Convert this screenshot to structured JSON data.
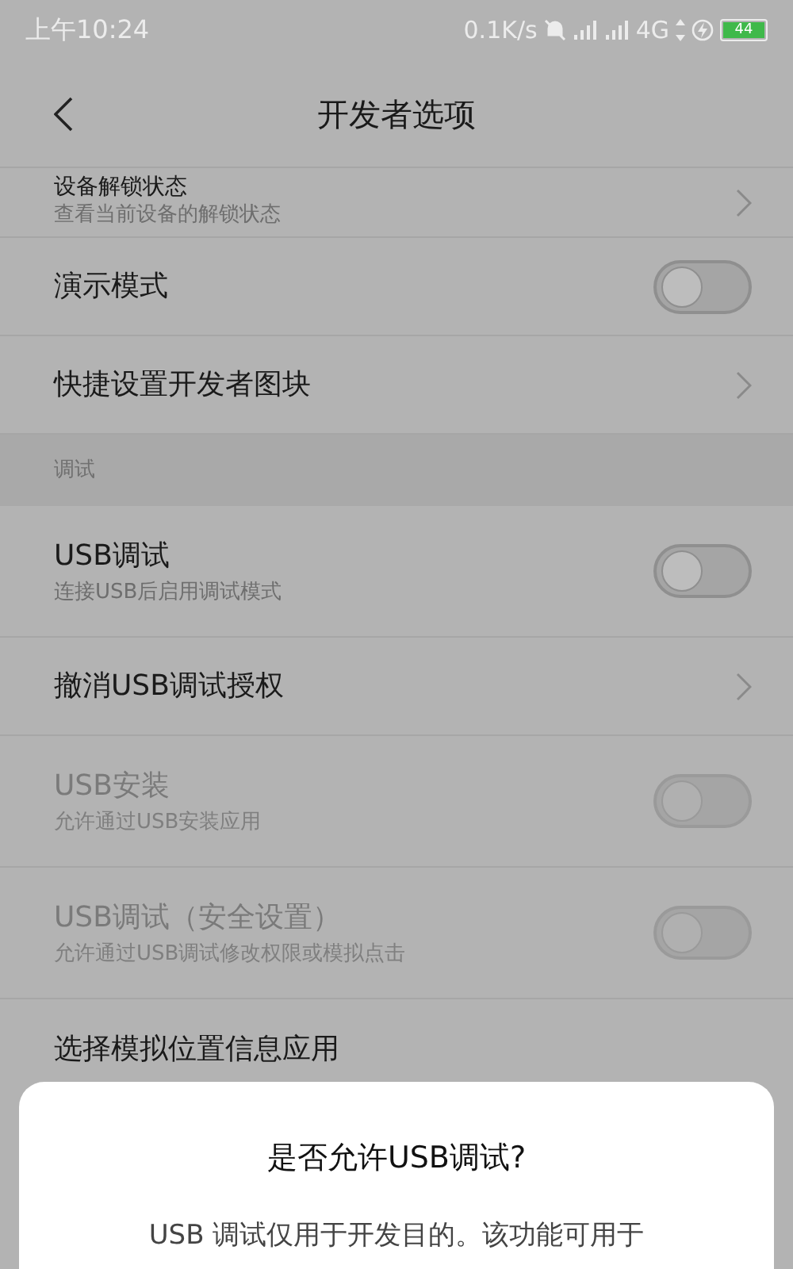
{
  "status_bar": {
    "time": "上午10:24",
    "speed": "0.1K/s",
    "network": "4G",
    "battery": "44"
  },
  "header": {
    "title": "开发者选项"
  },
  "rows": [
    {
      "kind": "link",
      "title": "设备解锁状态",
      "subtitle": "查看当前设备的解锁状态",
      "disabled": false
    },
    {
      "kind": "toggle",
      "title": "演示模式",
      "on": false,
      "disabled": false
    },
    {
      "kind": "link",
      "title": "快捷设置开发者图块",
      "disabled": false
    },
    {
      "kind": "section",
      "title": "调试"
    },
    {
      "kind": "toggle",
      "title": "USB调试",
      "subtitle": "连接USB后启用调试模式",
      "on": false,
      "disabled": false
    },
    {
      "kind": "link",
      "title": "撤消USB调试授权",
      "disabled": false
    },
    {
      "kind": "toggle",
      "title": "USB安装",
      "subtitle": "允许通过USB安装应用",
      "on": false,
      "disabled": true
    },
    {
      "kind": "toggle",
      "title": "USB调试（安全设置）",
      "subtitle": "允许通过USB调试修改权限或模拟点击",
      "on": false,
      "disabled": true
    },
    {
      "kind": "link",
      "title": "选择模拟位置信息应用",
      "disabled": false
    }
  ],
  "dialog": {
    "title": "是否允许USB调试?",
    "message": "USB 调试仅用于开发目的。该功能可用于"
  }
}
